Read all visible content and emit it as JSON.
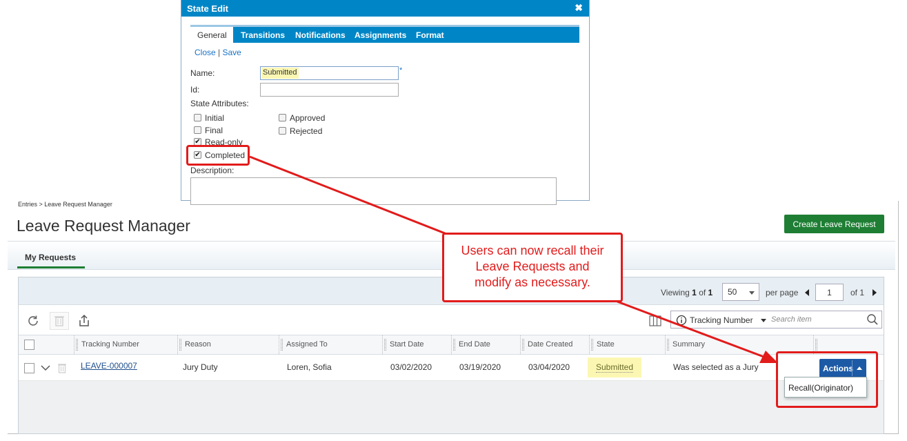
{
  "dialog": {
    "title": "State Edit",
    "close_icon": "close-icon",
    "tabs": [
      "General",
      "Transitions",
      "Notifications",
      "Assignments",
      "Format"
    ],
    "links": {
      "close": "Close",
      "separator": "|",
      "save": "Save"
    },
    "name_label": "Name:",
    "name_value": "Submitted",
    "required_marker": "*",
    "id_label": "Id:",
    "state_attributes_label": "State Attributes:",
    "checkboxes": [
      {
        "label": "Initial",
        "checked": false
      },
      {
        "label": "Final",
        "checked": false
      },
      {
        "label": "Read-only",
        "checked": true
      },
      {
        "label": "Completed",
        "checked": true
      },
      {
        "label": "Approved",
        "checked": false
      },
      {
        "label": "Rejected",
        "checked": false
      }
    ],
    "description_label": "Description:"
  },
  "page": {
    "breadcrumb": "Entries > Leave Request Manager",
    "title": "Leave Request Manager",
    "create_button": "Create Leave Request",
    "tab": "My Requests"
  },
  "pager": {
    "viewing_prefix": "Viewing",
    "range": "1",
    "of_word": "of",
    "total": "1",
    "per_page_value": "50",
    "per_page_label": "per page",
    "page_number": "1",
    "page_of": "of",
    "page_total": "1"
  },
  "search": {
    "field": "Tracking Number",
    "placeholder": "Search item"
  },
  "columns": [
    "Tracking Number",
    "Reason",
    "Assigned To",
    "Start Date",
    "End Date",
    "Date Created",
    "State",
    "Summary",
    ""
  ],
  "row": {
    "tracking_number": "LEAVE-000007",
    "reason": "Jury Duty",
    "assigned_to": "Loren, Sofia",
    "start_date": "03/02/2020",
    "end_date": "03/19/2020",
    "date_created": "03/04/2020",
    "state": "Submitted",
    "summary": "Was selected as a Jury"
  },
  "actions": {
    "button": "Actions",
    "menu_items": [
      "Recall(Originator)"
    ]
  },
  "callout": {
    "line1": "Users can now recall their",
    "line2": "Leave Requests and",
    "line3": "modify as necessary."
  },
  "colors": {
    "accent_red": "#e21b1b",
    "dialog_blue": "#0086c6",
    "create_green": "#1e7e34",
    "actions_blue": "#1d5aa6",
    "highlight_yellow": "#fbf7b3"
  }
}
